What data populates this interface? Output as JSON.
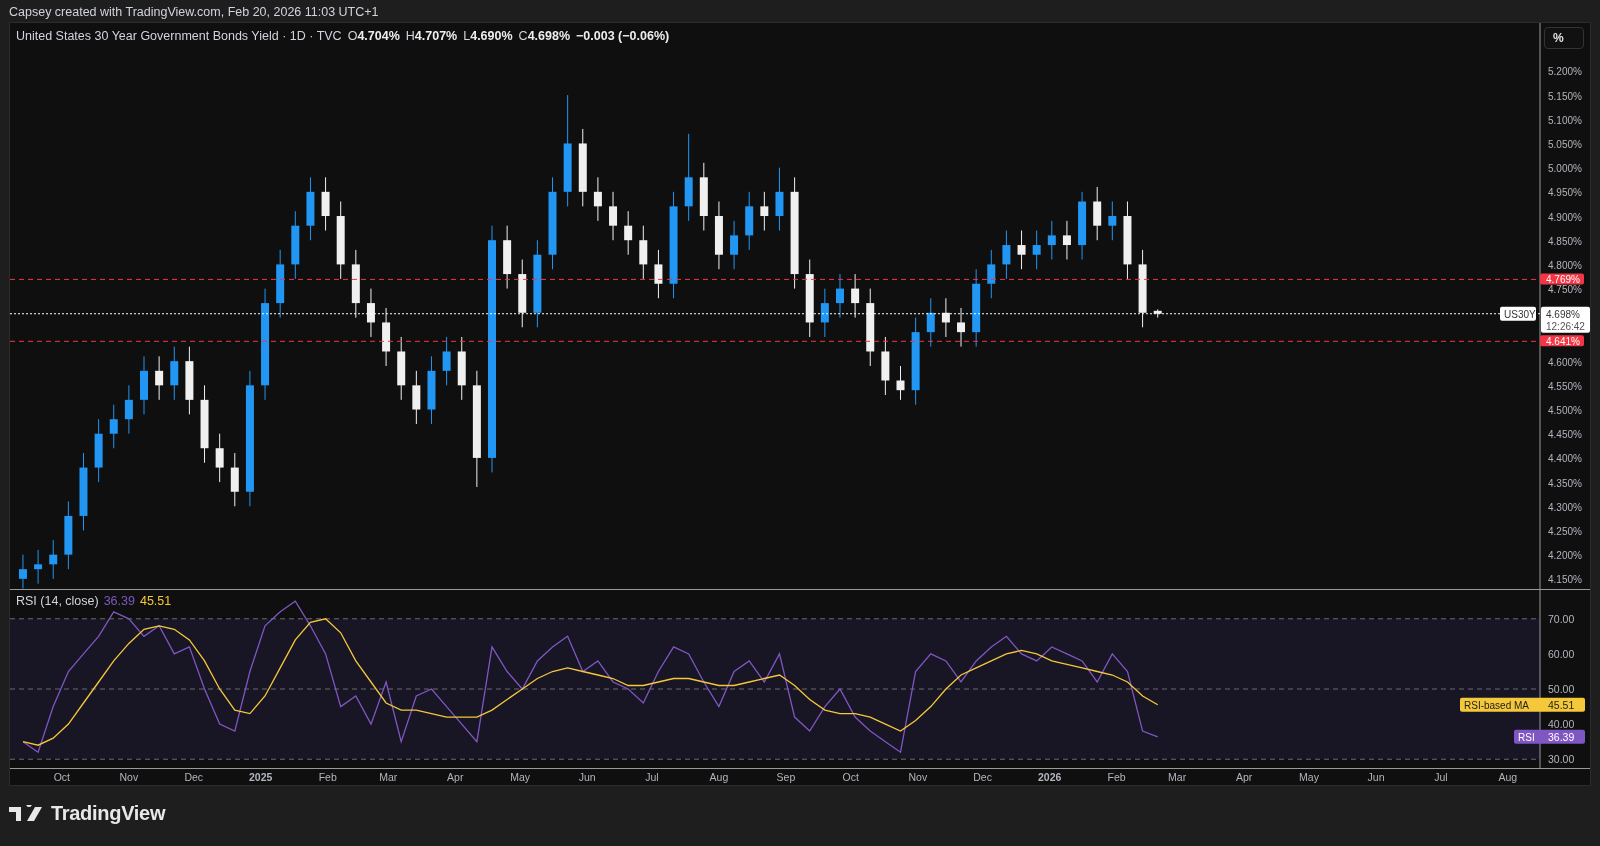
{
  "attribution": "Capsey created with TradingView.com, Feb 20, 2026 11:03 UTC+1",
  "price_pane": {
    "legend": {
      "title": "United States 30 Year Government Bonds Yield · 1D · TVC",
      "ohlc": [
        {
          "key": "O",
          "value": "4.704%"
        },
        {
          "key": "H",
          "value": "4.707%"
        },
        {
          "key": "L",
          "value": "4.690%"
        },
        {
          "key": "C",
          "value": "4.698%"
        }
      ],
      "change": "−0.003 (−0.06%)"
    },
    "scale_button": "%",
    "last_price": {
      "symbol": "US30Y",
      "countdown": "12:26:42"
    },
    "chart_data": {
      "type": "candlestick",
      "xlim": [
        "2024-09-07",
        "2026-09-08"
      ],
      "ylim": [
        4.129,
        5.299
      ],
      "x": [
        "2024-09-13",
        "2024-09-20",
        "2024-09-27",
        "2024-10-04",
        "2024-10-11",
        "2024-10-18",
        "2024-10-25",
        "2024-11-01",
        "2024-11-08",
        "2024-11-15",
        "2024-11-22",
        "2024-11-29",
        "2024-12-06",
        "2024-12-13",
        "2024-12-20",
        "2024-12-27",
        "2025-01-03",
        "2025-01-10",
        "2025-01-17",
        "2025-01-24",
        "2025-01-31",
        "2025-02-07",
        "2025-02-14",
        "2025-02-21",
        "2025-02-28",
        "2025-03-07",
        "2025-03-14",
        "2025-03-21",
        "2025-03-28",
        "2025-04-04",
        "2025-04-11",
        "2025-04-18",
        "2025-04-25",
        "2025-05-02",
        "2025-05-09",
        "2025-05-16",
        "2025-05-23",
        "2025-05-30",
        "2025-06-06",
        "2025-06-13",
        "2025-06-20",
        "2025-06-27",
        "2025-07-04",
        "2025-07-11",
        "2025-07-18",
        "2025-07-25",
        "2025-08-01",
        "2025-08-08",
        "2025-08-15",
        "2025-08-22",
        "2025-08-29",
        "2025-09-05",
        "2025-09-12",
        "2025-09-19",
        "2025-09-26",
        "2025-10-03",
        "2025-10-10",
        "2025-10-17",
        "2025-10-24",
        "2025-10-31",
        "2025-11-07",
        "2025-11-14",
        "2025-11-21",
        "2025-11-28",
        "2025-12-05",
        "2025-12-12",
        "2025-12-19",
        "2025-12-26",
        "2026-01-02",
        "2026-01-09",
        "2026-01-16",
        "2026-01-23",
        "2026-01-30",
        "2026-02-06",
        "2026-02-13",
        "2026-02-20"
      ],
      "ohlc": [
        [
          4.15,
          4.2,
          4.13,
          4.17
        ],
        [
          4.17,
          4.21,
          4.14,
          4.18
        ],
        [
          4.18,
          4.23,
          4.15,
          4.2
        ],
        [
          4.2,
          4.31,
          4.17,
          4.28
        ],
        [
          4.28,
          4.41,
          4.25,
          4.38
        ],
        [
          4.38,
          4.48,
          4.35,
          4.45
        ],
        [
          4.45,
          4.51,
          4.42,
          4.48
        ],
        [
          4.48,
          4.55,
          4.45,
          4.52
        ],
        [
          4.52,
          4.61,
          4.49,
          4.58
        ],
        [
          4.58,
          4.61,
          4.52,
          4.55
        ],
        [
          4.55,
          4.63,
          4.52,
          4.6
        ],
        [
          4.6,
          4.63,
          4.49,
          4.52
        ],
        [
          4.52,
          4.55,
          4.39,
          4.42
        ],
        [
          4.42,
          4.45,
          4.35,
          4.38
        ],
        [
          4.38,
          4.41,
          4.3,
          4.33
        ],
        [
          4.33,
          4.58,
          4.3,
          4.55
        ],
        [
          4.55,
          4.75,
          4.52,
          4.72
        ],
        [
          4.72,
          4.83,
          4.69,
          4.8
        ],
        [
          4.8,
          4.91,
          4.77,
          4.88
        ],
        [
          4.88,
          4.98,
          4.85,
          4.95
        ],
        [
          4.95,
          4.98,
          4.87,
          4.9
        ],
        [
          4.9,
          4.93,
          4.77,
          4.8
        ],
        [
          4.8,
          4.83,
          4.69,
          4.72
        ],
        [
          4.72,
          4.75,
          4.65,
          4.68
        ],
        [
          4.68,
          4.71,
          4.59,
          4.62
        ],
        [
          4.62,
          4.65,
          4.52,
          4.55
        ],
        [
          4.55,
          4.58,
          4.47,
          4.5
        ],
        [
          4.5,
          4.61,
          4.47,
          4.58
        ],
        [
          4.58,
          4.65,
          4.55,
          4.62
        ],
        [
          4.62,
          4.65,
          4.52,
          4.55
        ],
        [
          4.55,
          4.58,
          4.34,
          4.4
        ],
        [
          4.4,
          4.88,
          4.37,
          4.85
        ],
        [
          4.85,
          4.88,
          4.75,
          4.78
        ],
        [
          4.78,
          4.81,
          4.67,
          4.7
        ],
        [
          4.7,
          4.85,
          4.67,
          4.82
        ],
        [
          4.82,
          4.98,
          4.79,
          4.95
        ],
        [
          4.95,
          5.15,
          4.92,
          5.05
        ],
        [
          5.05,
          5.08,
          4.92,
          4.95
        ],
        [
          4.95,
          4.98,
          4.89,
          4.92
        ],
        [
          4.92,
          4.95,
          4.85,
          4.88
        ],
        [
          4.88,
          4.91,
          4.82,
          4.85
        ],
        [
          4.85,
          4.88,
          4.77,
          4.8
        ],
        [
          4.8,
          4.83,
          4.73,
          4.76
        ],
        [
          4.76,
          4.95,
          4.73,
          4.92
        ],
        [
          4.92,
          5.07,
          4.89,
          4.98
        ],
        [
          4.98,
          5.01,
          4.87,
          4.9
        ],
        [
          4.9,
          4.93,
          4.79,
          4.82
        ],
        [
          4.82,
          4.89,
          4.79,
          4.86
        ],
        [
          4.86,
          4.95,
          4.83,
          4.92
        ],
        [
          4.92,
          4.95,
          4.87,
          4.9
        ],
        [
          4.9,
          5.0,
          4.87,
          4.95
        ],
        [
          4.95,
          4.98,
          4.75,
          4.78
        ],
        [
          4.78,
          4.81,
          4.65,
          4.68
        ],
        [
          4.68,
          4.75,
          4.65,
          4.72
        ],
        [
          4.72,
          4.78,
          4.69,
          4.75
        ],
        [
          4.75,
          4.78,
          4.69,
          4.72
        ],
        [
          4.72,
          4.75,
          4.59,
          4.62
        ],
        [
          4.62,
          4.65,
          4.53,
          4.56
        ],
        [
          4.56,
          4.59,
          4.52,
          4.54
        ],
        [
          4.54,
          4.69,
          4.51,
          4.66
        ],
        [
          4.66,
          4.73,
          4.63,
          4.7
        ],
        [
          4.7,
          4.73,
          4.65,
          4.68
        ],
        [
          4.68,
          4.71,
          4.63,
          4.66
        ],
        [
          4.66,
          4.79,
          4.63,
          4.76
        ],
        [
          4.76,
          4.83,
          4.73,
          4.8
        ],
        [
          4.8,
          4.87,
          4.77,
          4.84
        ],
        [
          4.84,
          4.87,
          4.79,
          4.82
        ],
        [
          4.82,
          4.87,
          4.79,
          4.84
        ],
        [
          4.84,
          4.89,
          4.81,
          4.86
        ],
        [
          4.86,
          4.89,
          4.81,
          4.84
        ],
        [
          4.84,
          4.95,
          4.81,
          4.93
        ],
        [
          4.93,
          4.96,
          4.85,
          4.88
        ],
        [
          4.88,
          4.93,
          4.85,
          4.9
        ],
        [
          4.9,
          4.93,
          4.77,
          4.8
        ],
        [
          4.8,
          4.83,
          4.67,
          4.7
        ],
        [
          4.704,
          4.707,
          4.69,
          4.698
        ]
      ],
      "yticks": [
        {
          "value": 5.2,
          "label": "5.200%"
        },
        {
          "value": 5.15,
          "label": "5.150%"
        },
        {
          "value": 5.1,
          "label": "5.100%"
        },
        {
          "value": 5.05,
          "label": "5.050%"
        },
        {
          "value": 5.0,
          "label": "5.000%"
        },
        {
          "value": 4.95,
          "label": "4.950%"
        },
        {
          "value": 4.9,
          "label": "4.900%"
        },
        {
          "value": 4.85,
          "label": "4.850%"
        },
        {
          "value": 4.8,
          "label": "4.800%"
        },
        {
          "value": 4.75,
          "label": "4.750%"
        },
        {
          "value": 4.6,
          "label": "4.600%"
        },
        {
          "value": 4.55,
          "label": "4.550%"
        },
        {
          "value": 4.5,
          "label": "4.500%"
        },
        {
          "value": 4.45,
          "label": "4.450%"
        },
        {
          "value": 4.4,
          "label": "4.400%"
        },
        {
          "value": 4.35,
          "label": "4.350%"
        },
        {
          "value": 4.3,
          "label": "4.300%"
        },
        {
          "value": 4.25,
          "label": "4.250%"
        },
        {
          "value": 4.2,
          "label": "4.200%"
        },
        {
          "value": 4.15,
          "label": "4.150%"
        }
      ],
      "ref_lines": [
        {
          "axis": "y",
          "value": 4.769,
          "label": "4.769%"
        },
        {
          "axis": "y",
          "value": 4.698,
          "label": "4.698%"
        },
        {
          "axis": "y",
          "value": 4.641,
          "label": "4.641%"
        }
      ]
    }
  },
  "rsi_pane": {
    "legend": {
      "label": "RSI (14, close)",
      "values": [
        "36.39",
        "45.51"
      ]
    },
    "chart_data": {
      "type": "line",
      "xlim": [
        "2024-09-07",
        "2026-09-08"
      ],
      "ylim": [
        27.5,
        78.2
      ],
      "grid": true,
      "bands": [
        {
          "axis": "y",
          "from": 30,
          "to": 70
        }
      ],
      "x": [
        "2024-09-13",
        "2024-09-20",
        "2024-09-27",
        "2024-10-04",
        "2024-10-11",
        "2024-10-18",
        "2024-10-25",
        "2024-11-01",
        "2024-11-08",
        "2024-11-15",
        "2024-11-22",
        "2024-11-29",
        "2024-12-06",
        "2024-12-13",
        "2024-12-20",
        "2024-12-27",
        "2025-01-03",
        "2025-01-10",
        "2025-01-17",
        "2025-01-24",
        "2025-01-31",
        "2025-02-07",
        "2025-02-14",
        "2025-02-21",
        "2025-02-28",
        "2025-03-07",
        "2025-03-14",
        "2025-03-21",
        "2025-03-28",
        "2025-04-04",
        "2025-04-11",
        "2025-04-18",
        "2025-04-25",
        "2025-05-02",
        "2025-05-09",
        "2025-05-16",
        "2025-05-23",
        "2025-05-30",
        "2025-06-06",
        "2025-06-13",
        "2025-06-20",
        "2025-06-27",
        "2025-07-04",
        "2025-07-11",
        "2025-07-18",
        "2025-07-25",
        "2025-08-01",
        "2025-08-08",
        "2025-08-15",
        "2025-08-22",
        "2025-08-29",
        "2025-09-05",
        "2025-09-12",
        "2025-09-19",
        "2025-09-26",
        "2025-10-03",
        "2025-10-10",
        "2025-10-17",
        "2025-10-24",
        "2025-10-31",
        "2025-11-07",
        "2025-11-14",
        "2025-11-21",
        "2025-11-28",
        "2025-12-05",
        "2025-12-12",
        "2025-12-19",
        "2025-12-26",
        "2026-01-02",
        "2026-01-09",
        "2026-01-16",
        "2026-01-23",
        "2026-01-30",
        "2026-02-06",
        "2026-02-13",
        "2026-02-20"
      ],
      "series": [
        {
          "name": "RSI",
          "color": "#7e57c2",
          "values": [
            35,
            32,
            45,
            55,
            60,
            65,
            72,
            70,
            65,
            68,
            60,
            62,
            50,
            40,
            38,
            55,
            68,
            72,
            75,
            68,
            60,
            45,
            48,
            40,
            52,
            35,
            48,
            50,
            45,
            40,
            35,
            62,
            55,
            50,
            58,
            62,
            65,
            55,
            58,
            52,
            50,
            46,
            55,
            62,
            60,
            52,
            45,
            55,
            58,
            52,
            60,
            42,
            38,
            45,
            50,
            42,
            38,
            35,
            32,
            55,
            60,
            58,
            52,
            58,
            62,
            65,
            60,
            58,
            62,
            60,
            58,
            52,
            60,
            55,
            38,
            36.4
          ]
        },
        {
          "name": "RSI-based MA",
          "color": "#f5c83a",
          "values": [
            35,
            34,
            36,
            40,
            46,
            52,
            58,
            63,
            67,
            68,
            67,
            64,
            58,
            50,
            44,
            43,
            48,
            56,
            64,
            69,
            70,
            66,
            58,
            52,
            46,
            44,
            44,
            43,
            42,
            42,
            42,
            44,
            47,
            50,
            53,
            55,
            56,
            55,
            54,
            53,
            51,
            51,
            52,
            53,
            53,
            52,
            51,
            51,
            52,
            53,
            54,
            51,
            47,
            44,
            43,
            43,
            42,
            40,
            38,
            41,
            45,
            50,
            54,
            56,
            58,
            60,
            61,
            60,
            58,
            57,
            56,
            55,
            54,
            52,
            48,
            45.5
          ]
        }
      ],
      "yticks": [
        {
          "value": 70,
          "label": "70.00"
        },
        {
          "value": 60,
          "label": "60.00"
        },
        {
          "value": 50,
          "label": "50.00"
        },
        {
          "value": 40,
          "label": "40.00"
        },
        {
          "value": 30,
          "label": "30.00"
        }
      ],
      "xticks": [
        {
          "value": "2024-10-01",
          "label": "Oct"
        },
        {
          "value": "2024-11-01",
          "label": "Nov"
        },
        {
          "value": "2024-12-01",
          "label": "Dec"
        },
        {
          "value": "2025-01-01",
          "label": "2025"
        },
        {
          "value": "2025-02-01",
          "label": "Feb"
        },
        {
          "value": "2025-03-01",
          "label": "Mar"
        },
        {
          "value": "2025-04-01",
          "label": "Apr"
        },
        {
          "value": "2025-05-01",
          "label": "May"
        },
        {
          "value": "2025-06-01",
          "label": "Jun"
        },
        {
          "value": "2025-07-01",
          "label": "Jul"
        },
        {
          "value": "2025-08-01",
          "label": "Aug"
        },
        {
          "value": "2025-09-01",
          "label": "Sep"
        },
        {
          "value": "2025-10-01",
          "label": "Oct"
        },
        {
          "value": "2025-11-01",
          "label": "Nov"
        },
        {
          "value": "2025-12-01",
          "label": "Dec"
        },
        {
          "value": "2026-01-01",
          "label": "2026"
        },
        {
          "value": "2026-02-01",
          "label": "Feb"
        },
        {
          "value": "2026-03-01",
          "label": "Mar"
        },
        {
          "value": "2026-04-01",
          "label": "Apr"
        },
        {
          "value": "2026-05-01",
          "label": "May"
        },
        {
          "value": "2026-06-01",
          "label": "Jun"
        },
        {
          "value": "2026-07-01",
          "label": "Jul"
        },
        {
          "value": "2026-08-01",
          "label": "Aug"
        }
      ]
    },
    "badges": [
      "45.51",
      "36.39"
    ]
  },
  "footer": {
    "logo_text": "TradingView"
  }
}
